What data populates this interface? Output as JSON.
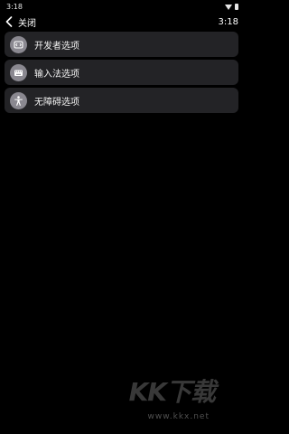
{
  "status_bar": {
    "time": "3:18"
  },
  "app_bar": {
    "back_label": "关闭",
    "time": "3:18"
  },
  "settings": {
    "items": [
      {
        "label": "开发者选项",
        "icon": "developer-options-icon"
      },
      {
        "label": "输入法选项",
        "icon": "keyboard-icon"
      },
      {
        "label": "无障碍选项",
        "icon": "accessibility-icon"
      }
    ]
  },
  "watermark": {
    "brand": "KK下载",
    "url": "www.kkx.net"
  },
  "colors": {
    "background": "#000000",
    "row_background": "#232326",
    "icon_circle": "#8a8890",
    "text": "#f2f2f2"
  }
}
